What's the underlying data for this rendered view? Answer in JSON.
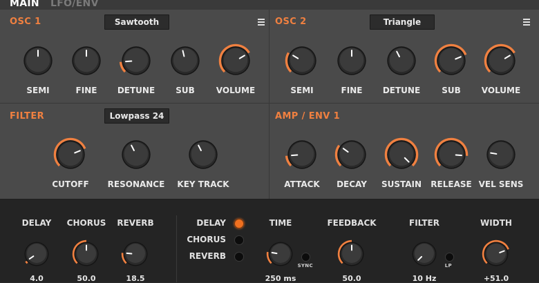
{
  "tabs": [
    "MAIN",
    "LFO/ENV"
  ],
  "accent_color": "#f08040",
  "osc1": {
    "title": "OSC 1",
    "waveform": "Sawtooth",
    "knobs": [
      {
        "label": "SEMI",
        "value": 0.5,
        "arc": false
      },
      {
        "label": "FINE",
        "value": 0.5,
        "arc": false
      },
      {
        "label": "DETUNE",
        "value": 0.15,
        "arc": true
      },
      {
        "label": "SUB",
        "value": 0.45,
        "arc": false
      },
      {
        "label": "VOLUME",
        "value": 0.72,
        "arc": true
      }
    ]
  },
  "osc2": {
    "title": "OSC 2",
    "waveform": "Triangle",
    "knobs": [
      {
        "label": "SEMI",
        "value": 0.28,
        "arc": true
      },
      {
        "label": "FINE",
        "value": 0.5,
        "arc": false
      },
      {
        "label": "DETUNE",
        "value": 0.4,
        "arc": false
      },
      {
        "label": "SUB",
        "value": 0.75,
        "arc": true
      },
      {
        "label": "VOLUME",
        "value": 0.72,
        "arc": true
      }
    ]
  },
  "filter": {
    "title": "FILTER",
    "type": "Lowpass 24",
    "knobs": [
      {
        "label": "CUTOFF",
        "value": 0.75,
        "arc": true
      },
      {
        "label": "RESONANCE",
        "value": 0.4,
        "arc": false
      },
      {
        "label": "KEY TRACK",
        "value": 0.4,
        "arc": false
      }
    ]
  },
  "amp": {
    "title": "AMP / ENV 1",
    "knobs": [
      {
        "label": "ATTACK",
        "value": 0.15,
        "arc": true
      },
      {
        "label": "DECAY",
        "value": 0.3,
        "arc": true
      },
      {
        "label": "SUSTAIN",
        "value": 1.0,
        "arc": true
      },
      {
        "label": "RELEASE",
        "value": 0.85,
        "arc": true
      },
      {
        "label": "VEL SENS",
        "value": 0.2,
        "arc": false
      }
    ]
  },
  "fx_mix": [
    {
      "label": "DELAY",
      "value_text": "4.0",
      "value": 0.04,
      "arc": true
    },
    {
      "label": "CHORUS",
      "value_text": "50.0",
      "value": 0.5,
      "arc": true
    },
    {
      "label": "REVERB",
      "value_text": "18.5",
      "value": 0.185,
      "arc": true
    }
  ],
  "fx_select": [
    {
      "label": "DELAY",
      "active": true
    },
    {
      "label": "CHORUS",
      "active": false
    },
    {
      "label": "REVERB",
      "active": false
    }
  ],
  "fx_params": [
    {
      "label": "TIME",
      "value_text": "250 ms",
      "value": 0.2,
      "arc": true,
      "toggle_label": "SYNC"
    },
    {
      "label": "FEEDBACK",
      "value_text": "50.0",
      "value": 0.5,
      "arc": true
    },
    {
      "label": "FILTER",
      "value_text": "10 Hz",
      "value": 0.0,
      "arc": false,
      "toggle_label": "LP"
    },
    {
      "label": "WIDTH",
      "value_text": "+51.0",
      "value": 0.755,
      "arc": true
    }
  ]
}
